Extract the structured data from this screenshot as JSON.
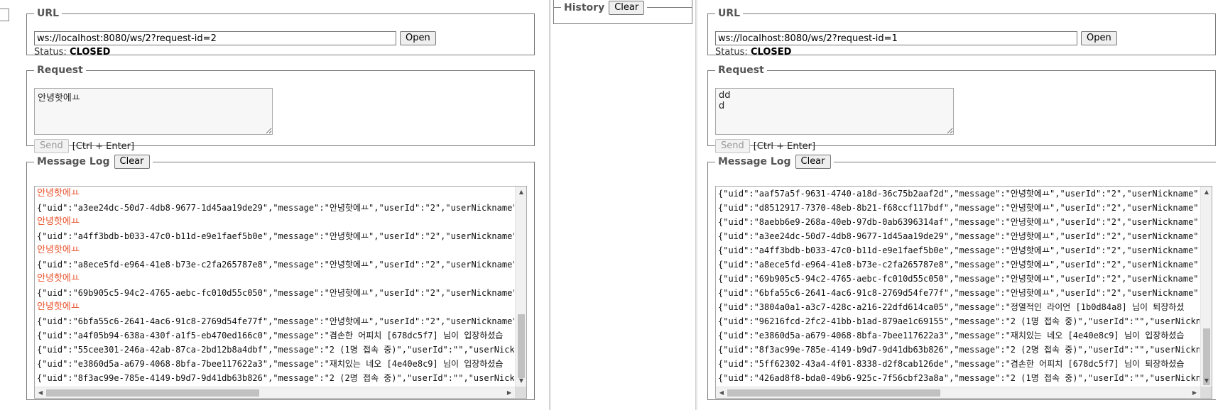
{
  "left": {
    "url_legend": "URL",
    "url_value": "ws://localhost:8080/ws/2?request-id=2",
    "open_label": "Open",
    "status_label": "Status:",
    "status_value": "CLOSED",
    "request_legend": "Request",
    "request_text": "안녕핫에ㅛ",
    "send_label": "Send",
    "send_hint": "[Ctrl + Enter]",
    "log_legend": "Message Log",
    "log_clear_label": "Clear",
    "log_lines": [
      {
        "text": "안녕핫에ㅛ",
        "accent": true
      },
      {
        "text": "{\"uid\":\"a3ee24dc-50d7-4db8-9677-1d45aa19de29\",\"message\":\"안녕핫에ㅛ\",\"userId\":\"2\",\"userNickname\"",
        "accent": false
      },
      {
        "text": "안녕핫에ㅛ",
        "accent": true
      },
      {
        "text": "{\"uid\":\"a4ff3bdb-b033-47c0-b11d-e9e1faef5b0e\",\"message\":\"안녕핫에ㅛ\",\"userId\":\"2\",\"userNickname\"",
        "accent": false
      },
      {
        "text": "안녕핫에ㅛ",
        "accent": true
      },
      {
        "text": "{\"uid\":\"a8ece5fd-e964-41e8-b73e-c2fa265787e8\",\"message\":\"안녕핫에ㅛ\",\"userId\":\"2\",\"userNickname\"",
        "accent": false
      },
      {
        "text": "안녕핫에ㅛ",
        "accent": true
      },
      {
        "text": "{\"uid\":\"69b905c5-94c2-4765-aebc-fc010d55c050\",\"message\":\"안녕핫에ㅛ\",\"userId\":\"2\",\"userNickname\"",
        "accent": false
      },
      {
        "text": "안녕핫에ㅛ",
        "accent": true
      },
      {
        "text": "{\"uid\":\"6bfa55c6-2641-4ac6-91c8-2769d54fe77f\",\"message\":\"안녕핫에ㅛ\",\"userId\":\"2\",\"userNickname\"",
        "accent": false
      },
      {
        "text": "{\"uid\":\"a4f05b94-638a-430f-a1f5-eb470ed166c0\",\"message\":\"겸손한 어피치 [678dc5f7] 님이 입장하셨습",
        "accent": false
      },
      {
        "text": "{\"uid\":\"55cee301-246a-42ab-87ca-2bd12b8a4dbf\",\"message\":\"2 (1명 접속 중)\",\"userId\":\"\",\"userNickn",
        "accent": false
      },
      {
        "text": "{\"uid\":\"e3860d5a-a679-4068-8bfa-7bee117622a3\",\"message\":\"재치있는 네오 [4e40e8c9] 님이 입장하셨습",
        "accent": false
      },
      {
        "text": "{\"uid\":\"8f3ac99e-785e-4149-b9d7-9d41db63b826\",\"message\":\"2 (2명 접속 중)\",\"userId\":\"\",\"userNickn",
        "accent": false
      }
    ]
  },
  "history": {
    "legend": "History",
    "clear_label": "Clear"
  },
  "right": {
    "url_legend": "URL",
    "url_value": "ws://localhost:8080/ws/2?request-id=1",
    "open_label": "Open",
    "status_label": "Status:",
    "status_value": "CLOSED",
    "request_legend": "Request",
    "request_text": "dd\nd",
    "send_label": "Send",
    "send_hint": "[Ctrl + Enter]",
    "log_legend": "Message Log",
    "log_clear_label": "Clear",
    "log_lines": [
      {
        "text": "{\"uid\":\"aaf57a5f-9631-4740-a18d-36c75b2aaf2d\",\"message\":\"안녕핫에ㅛ\",\"userId\":\"2\",\"userNickname\"",
        "accent": false
      },
      {
        "text": "{\"uid\":\"d8512917-7370-48eb-8b21-f68ccf117bdf\",\"message\":\"안녕핫에ㅛ\",\"userId\":\"2\",\"userNickname\"",
        "accent": false
      },
      {
        "text": "{\"uid\":\"8aebb6e9-268a-40eb-97db-0ab6396314af\",\"message\":\"안녕핫에ㅛ\",\"userId\":\"2\",\"userNickname\"",
        "accent": false
      },
      {
        "text": "{\"uid\":\"a3ee24dc-50d7-4db8-9677-1d45aa19de29\",\"message\":\"안녕핫에ㅛ\",\"userId\":\"2\",\"userNickname\"",
        "accent": false
      },
      {
        "text": "{\"uid\":\"a4ff3bdb-b033-47c0-b11d-e9e1faef5b0e\",\"message\":\"안녕핫에ㅛ\",\"userId\":\"2\",\"userNickname\"",
        "accent": false
      },
      {
        "text": "{\"uid\":\"a8ece5fd-e964-41e8-b73e-c2fa265787e8\",\"message\":\"안녕핫에ㅛ\",\"userId\":\"2\",\"userNickname\"",
        "accent": false
      },
      {
        "text": "{\"uid\":\"69b905c5-94c2-4765-aebc-fc010d55c050\",\"message\":\"안녕핫에ㅛ\",\"userId\":\"2\",\"userNickname\"",
        "accent": false
      },
      {
        "text": "{\"uid\":\"6bfa55c6-2641-4ac6-91c8-2769d54fe77f\",\"message\":\"안녕핫에ㅛ\",\"userId\":\"2\",\"userNickname\"",
        "accent": false
      },
      {
        "text": "{\"uid\":\"3804a0a1-a3c7-428c-a216-22dfd614ca05\",\"message\":\"정열적인 라이언 [1b0d84a8] 님이 퇴장하셨",
        "accent": false
      },
      {
        "text": "{\"uid\":\"96216fcd-2fc2-41bb-b1ad-879ae1c69155\",\"message\":\"2 (1명 접속 중)\",\"userId\":\"\",\"userNickn",
        "accent": false
      },
      {
        "text": "{\"uid\":\"e3860d5a-a679-4068-8bfa-7bee117622a3\",\"message\":\"재치있는 네오 [4e40e8c9] 님이 입장하셨습",
        "accent": false
      },
      {
        "text": "{\"uid\":\"8f3ac99e-785e-4149-b9d7-9d41db63b826\",\"message\":\"2 (2명 접속 중)\",\"userId\":\"\",\"userNickn",
        "accent": false
      },
      {
        "text": "{\"uid\":\"5ff62302-43a4-4f01-8338-d2f8cab126de\",\"message\":\"겸손한 어피치 [678dc5f7] 님이 퇴장하셨습",
        "accent": false
      },
      {
        "text": "{\"uid\":\"426ad8f8-bda0-49b6-925c-7f56cbf23a8a\",\"message\":\"2 (1명 접속 중)\",\"userId\":\"\",\"userNickn",
        "accent": false
      }
    ]
  },
  "colors": {
    "accent_text": "#e8502a",
    "legend_text": "#555555",
    "border": "#7a7a7a"
  }
}
